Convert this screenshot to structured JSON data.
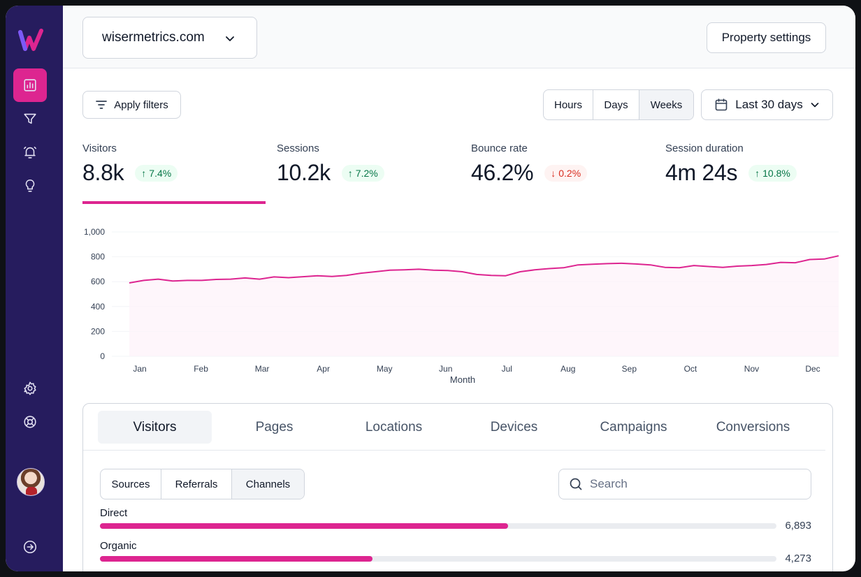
{
  "brand": {
    "accent": "#dd2590",
    "sidebar_bg": "#261c5e"
  },
  "sidebar": {
    "items": [
      {
        "icon": "bar-chart-icon",
        "active": true
      },
      {
        "icon": "filter-icon",
        "active": false
      },
      {
        "icon": "bell-icon",
        "active": false
      },
      {
        "icon": "lightbulb-icon",
        "active": false
      },
      {
        "icon": "gear-icon",
        "active": false
      },
      {
        "icon": "lifebuoy-icon",
        "active": false
      },
      {
        "icon": "arrow-right-circle-icon",
        "active": false
      }
    ]
  },
  "header": {
    "site": "wisermetrics.com",
    "property_settings": "Property settings"
  },
  "toolbar": {
    "apply_filters": "Apply filters",
    "granularity": [
      "Hours",
      "Days",
      "Weeks"
    ],
    "granularity_selected": "Weeks",
    "date_range": "Last 30 days"
  },
  "stats": [
    {
      "label": "Visitors",
      "value": "8.8k",
      "change": "7.4%",
      "direction": "up"
    },
    {
      "label": "Sessions",
      "value": "10.2k",
      "change": "7.2%",
      "direction": "up"
    },
    {
      "label": "Bounce rate",
      "value": "46.2%",
      "change": "0.2%",
      "direction": "down"
    },
    {
      "label": "Session duration",
      "value": "4m 24s",
      "change": "10.8%",
      "direction": "up"
    }
  ],
  "chart_data": {
    "type": "area",
    "xlabel": "Month",
    "ylabel": "",
    "ylim": [
      0,
      1000
    ],
    "yticks": [
      "0",
      "200",
      "400",
      "600",
      "800",
      "1,000"
    ],
    "yticks_values": [
      0,
      200,
      400,
      600,
      800,
      1000
    ],
    "xticks": [
      "Jan",
      "Feb",
      "Mar",
      "Apr",
      "May",
      "Jun",
      "Jul",
      "Aug",
      "Sep",
      "Oct",
      "Nov",
      "Dec"
    ],
    "grid": true,
    "series": [
      {
        "values": [
          590,
          610,
          620,
          605,
          610,
          610,
          618,
          620,
          630,
          620,
          638,
          632,
          640,
          648,
          642,
          650,
          668,
          680,
          692,
          695,
          700,
          692,
          690,
          680,
          658,
          650,
          648,
          680,
          695,
          705,
          712,
          735,
          740,
          745,
          748,
          742,
          735,
          715,
          712,
          730,
          722,
          715,
          725,
          730,
          738,
          755,
          752,
          778,
          782,
          808
        ],
        "color": "#dd2590"
      }
    ]
  },
  "panel": {
    "tabs": [
      "Visitors",
      "Pages",
      "Locations",
      "Devices",
      "Campaigns",
      "Conversions"
    ],
    "tab_selected": "Visitors",
    "subtabs": [
      "Sources",
      "Referrals",
      "Channels"
    ],
    "subtab_selected": "Channels",
    "search_placeholder": "Search",
    "channels": [
      {
        "name": "Direct",
        "value": "6,893",
        "share": 0.603
      },
      {
        "name": "Organic",
        "value": "4,273",
        "share": 0.403
      }
    ]
  }
}
